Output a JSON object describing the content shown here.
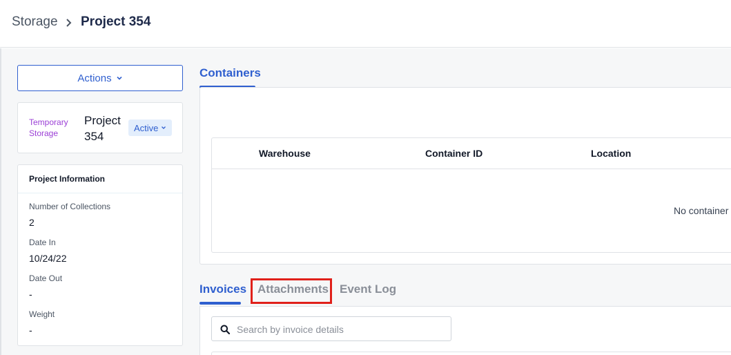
{
  "breadcrumb": {
    "root": "Storage",
    "current": "Project 354"
  },
  "actions": {
    "label": "Actions"
  },
  "project": {
    "type": "Temporary Storage",
    "name": "Project 354",
    "status": "Active"
  },
  "project_info": {
    "title": "Project Information",
    "fields": [
      {
        "label": "Number of Collections",
        "value": "2"
      },
      {
        "label": "Date In",
        "value": "10/24/22"
      },
      {
        "label": "Date Out",
        "value": "-"
      },
      {
        "label": "Weight",
        "value": "-"
      }
    ]
  },
  "containers": {
    "tab_label": "Containers",
    "columns": [
      "Warehouse",
      "Container ID",
      "Location"
    ],
    "empty_message": "No container"
  },
  "bottom_tabs": [
    "Invoices",
    "Attachments",
    "Event Log"
  ],
  "active_bottom_tab": "Invoices",
  "search": {
    "placeholder": "Search by invoice details",
    "value": ""
  },
  "colors": {
    "accent": "#2f5fcf",
    "type_label": "#9b3fd6",
    "highlight": "#e0201a",
    "badge_bg": "#e3eefc"
  },
  "icons": {
    "breadcrumb_separator": "chevron-right-icon",
    "dropdown": "chevron-down-icon",
    "search": "search-icon"
  }
}
